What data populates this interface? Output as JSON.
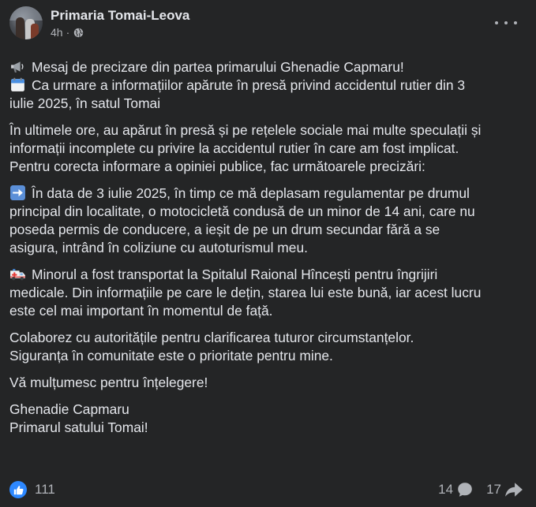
{
  "post": {
    "page_name": "Primaria Tomai-Leova",
    "time": "4h",
    "separator": "·",
    "audience_icon": "globe-icon",
    "more_icon": "more-options-icon"
  },
  "content": {
    "intro": [
      {
        "emoji": "megaphone-icon",
        "text": "Mesaj de precizare din partea primarului Ghenadie Capmaru!"
      },
      {
        "emoji": "calendar-icon",
        "text": "Ca urmare a informațiilor apărute în presă privind accidentul rutier din 3"
      },
      {
        "text": "iulie 2025, în satul Tomai"
      }
    ],
    "p1": [
      "În ultimele ore, au apărut în presă și pe rețelele sociale mai multe speculații și",
      "informații incomplete cu privire la accidentul rutier în care am fost implicat.",
      "Pentru corecta informare a opiniei publice, fac următoarele precizări:"
    ],
    "p2": {
      "emoji": "right-arrow-icon",
      "lines": [
        "În data de 3 iulie 2025, în timp ce mă deplasam regulamentar pe drumul",
        "principal din localitate, o motocicletă condusă de un minor de 14 ani, care nu",
        "poseda permis de conducere, a ieșit de pe un drum secundar fără a se",
        "asigura, intrând în coliziune cu autoturismul meu."
      ]
    },
    "p3": {
      "emoji": "ambulance-icon",
      "lines": [
        "Minorul a fost transportat la Spitalul Raional Hîncești pentru îngrijiri",
        "medicale. Din informațiile pe care le dețin, starea lui este bună, iar acest lucru",
        "este cel mai important în momentul de față."
      ]
    },
    "p4": [
      "Colaborez cu autoritățile pentru clarificarea tuturor circumstanțelor.",
      "Siguranța în comunitate este o prioritate pentru mine."
    ],
    "p5": [
      "Vă mulțumesc pentru înțelegere!"
    ],
    "p6": [
      "Ghenadie Capmaru",
      "Primarul satului Tomai!"
    ]
  },
  "footer": {
    "like_icon": "like-icon",
    "likes": "111",
    "comments": "14",
    "comment_icon": "comment-icon",
    "shares": "17",
    "share_icon": "share-icon"
  },
  "colors": {
    "background": "#242526",
    "text": "#e4e6eb",
    "secondary_text": "#b0b3b8",
    "like_blue": "#2d88ff"
  }
}
